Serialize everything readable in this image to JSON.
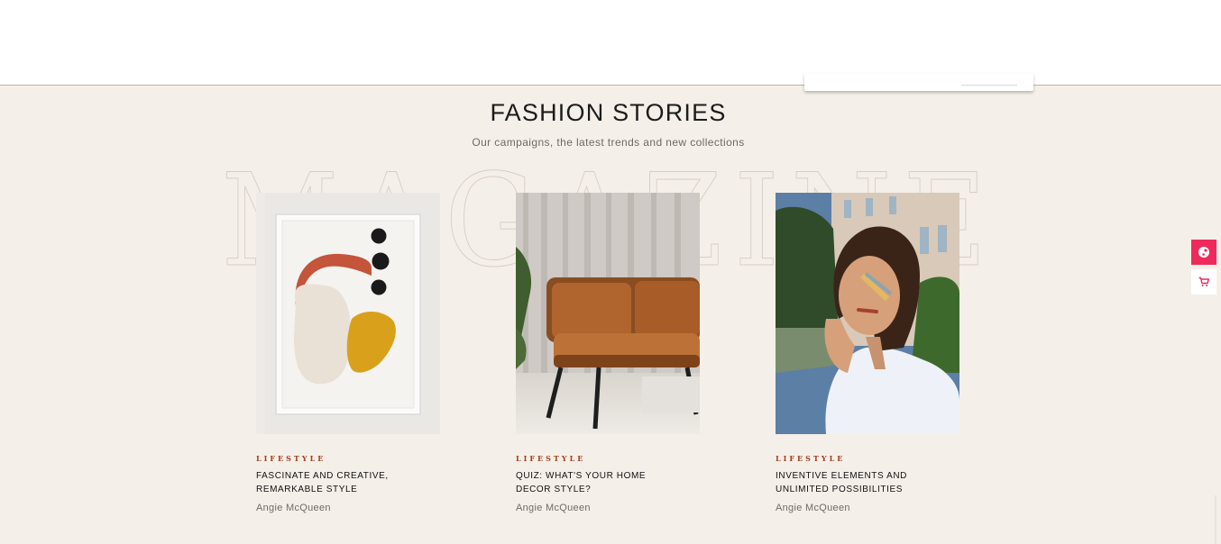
{
  "section": {
    "title": "FASHION STORIES",
    "subtitle": "Our campaigns, the latest trends and new collections",
    "watermark": "MAGAZINE"
  },
  "cards": [
    {
      "category": "LIFESTYLE",
      "title": "FASCINATE AND CREATIVE, REMARKABLE STYLE",
      "author": "Angie McQueen",
      "image": "abstract-art-frame"
    },
    {
      "category": "LIFESTYLE",
      "title": "QUIZ: WHAT'S YOUR HOME DECOR STYLE?",
      "author": "Angie McQueen",
      "image": "leather-sofa"
    },
    {
      "category": "LIFESTYLE",
      "title": "INVENTIVE ELEMENTS AND UNLIMITED POSSIBILITIES",
      "author": "Angie McQueen",
      "image": "woman-portrait"
    }
  ],
  "side_tabs": [
    {
      "icon": "palette-icon",
      "color": "#ee2a5c"
    },
    {
      "icon": "cart-icon",
      "color": "#ee2a5c"
    }
  ],
  "colors": {
    "background": "#f5efe9",
    "accent": "#ee2a5c",
    "category": "#a0401f"
  }
}
